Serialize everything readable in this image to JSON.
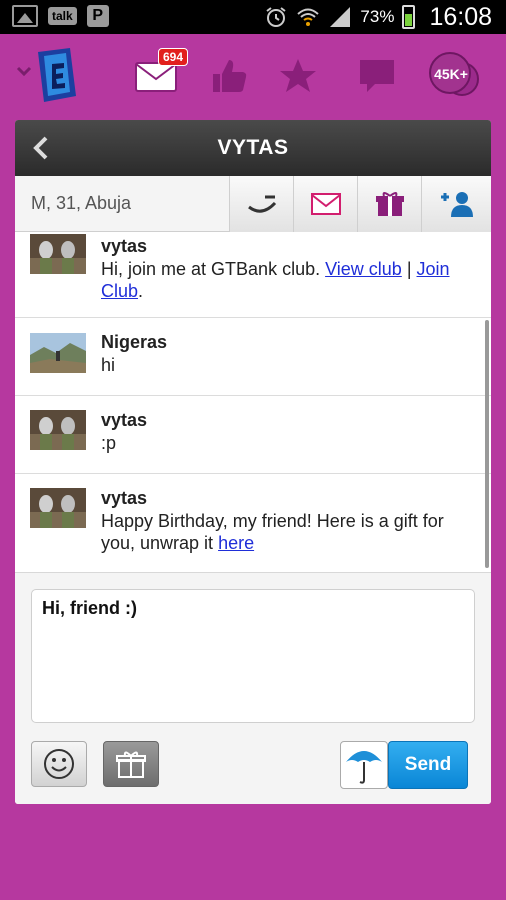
{
  "status_bar": {
    "talk_label": "talk",
    "p_label": "P",
    "battery_percent": "73%",
    "time": "16:08"
  },
  "top_nav": {
    "mail_badge": "694",
    "score_badge": "45K+"
  },
  "header": {
    "title": "VYTAS"
  },
  "profile": {
    "info": "M, 31, Abuja"
  },
  "messages": [
    {
      "name": "vytas",
      "text_prefix": "Hi, join me at GTBank club. ",
      "link1": "View club",
      "separator": " | ",
      "link2": "Join Club",
      "text_suffix": "."
    },
    {
      "name": "Nigeras",
      "text": "hi"
    },
    {
      "name": "vytas",
      "text": ":p"
    },
    {
      "name": "vytas",
      "text_prefix": "Happy Birthday, my friend! Here is a gift for you, unwrap it ",
      "link": "here"
    }
  ],
  "compose": {
    "value": "Hi, friend :)",
    "send_label": "Send"
  },
  "colors": {
    "background": "#b6389f",
    "header": "#3a3a3a",
    "accent_purple": "#8a1f7a",
    "send_blue": "#1a9be6",
    "link_blue": "#1f2ed8",
    "badge_red": "#e2201d"
  }
}
